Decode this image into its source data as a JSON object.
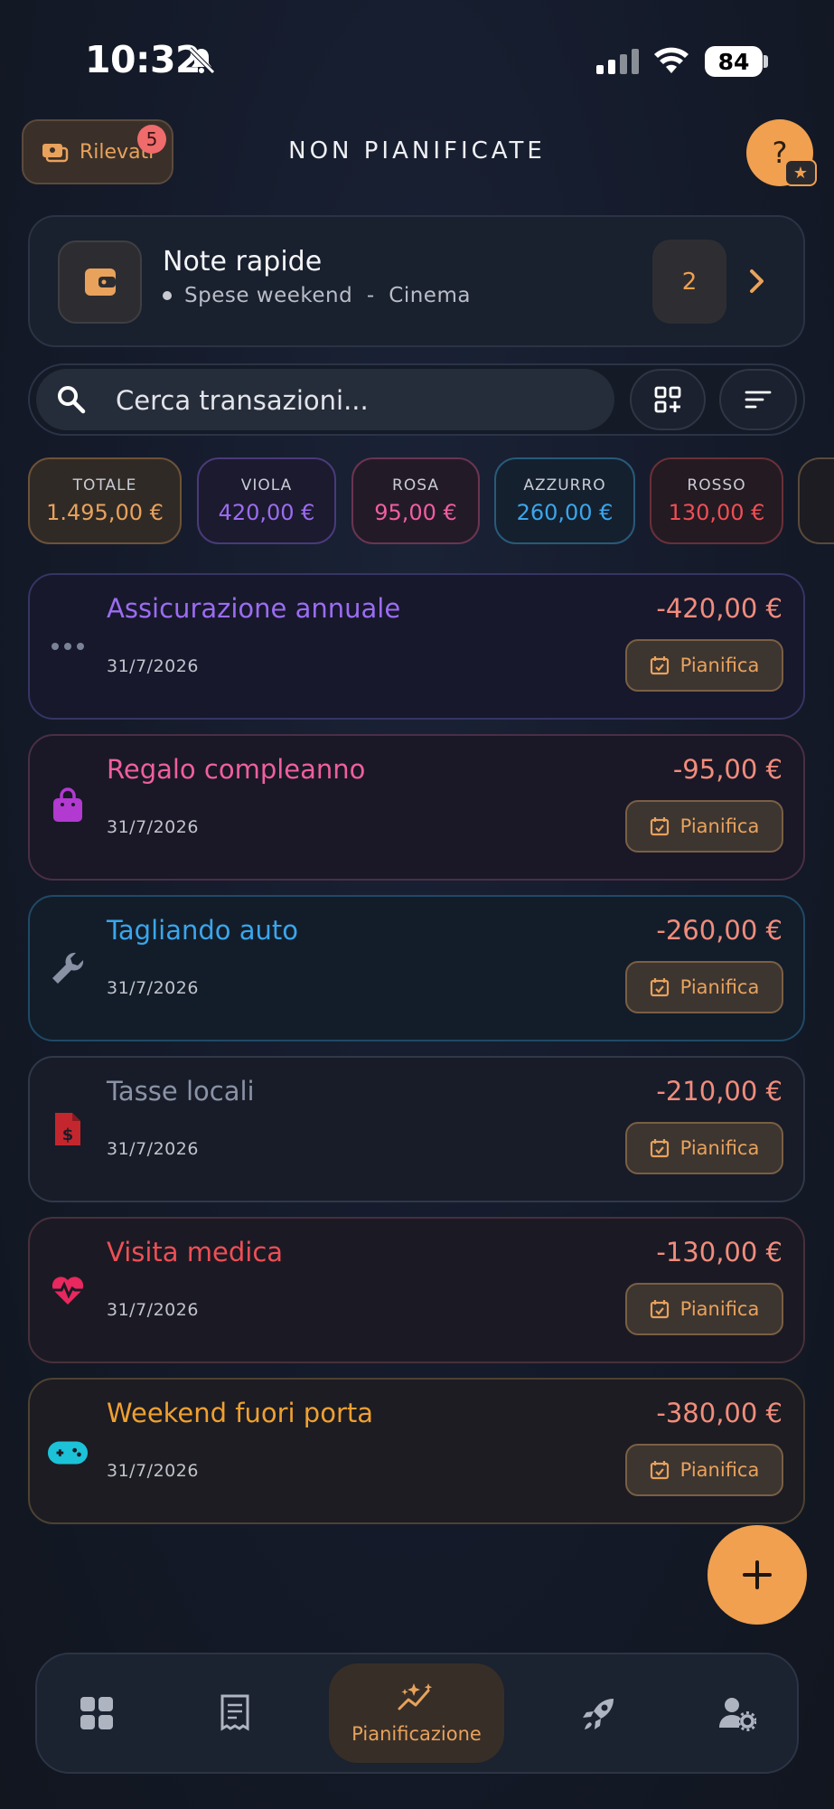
{
  "status_bar": {
    "time": "10:32",
    "battery": "84",
    "icons": [
      "bell-slash-icon",
      "signal-icon",
      "wifi-icon",
      "battery-icon"
    ]
  },
  "header": {
    "rilevati_label": "Rilevati",
    "rilevati_badge": "5",
    "title": "NON PIANIFICATE",
    "help_label": "?",
    "help_star": "★"
  },
  "note_rapide": {
    "title": "Note rapide",
    "subtitle": "Spese weekend  -  Cinema",
    "count": "2"
  },
  "search": {
    "placeholder": "Cerca transazioni..."
  },
  "chips": [
    {
      "label": "TOTALE",
      "value": "1.495,00 €",
      "color": "#e8a25c"
    },
    {
      "label": "VIOLA",
      "value": "420,00 €",
      "color": "#9b6cf0"
    },
    {
      "label": "ROSA",
      "value": "95,00 €",
      "color": "#ef5fa0"
    },
    {
      "label": "AZZURRO",
      "value": "260,00 €",
      "color": "#3aa6ec"
    },
    {
      "label": "ROSSO",
      "value": "130,00 €",
      "color": "#ee4f55"
    }
  ],
  "transactions": [
    {
      "title": "Assicurazione annuale",
      "date": "31/7/2026",
      "amount": "-420,00 €",
      "color": "#9b6cf0",
      "icon": "more-dots-icon",
      "action": "Pianifica"
    },
    {
      "title": "Regalo compleanno",
      "date": "31/7/2026",
      "amount": "-95,00 €",
      "color": "#ef5fa0",
      "icon": "shopping-bag-icon",
      "action": "Pianifica"
    },
    {
      "title": "Tagliando auto",
      "date": "31/7/2026",
      "amount": "-260,00 €",
      "color": "#3aa6ec",
      "icon": "wrench-icon",
      "action": "Pianifica"
    },
    {
      "title": "Tasse locali",
      "date": "31/7/2026",
      "amount": "-210,00 €",
      "color": "#8a93a6",
      "icon": "tax-document-icon",
      "action": "Pianifica"
    },
    {
      "title": "Visita medica",
      "date": "31/7/2026",
      "amount": "-130,00 €",
      "color": "#ee4f55",
      "icon": "heart-pulse-icon",
      "action": "Pianifica"
    },
    {
      "title": "Weekend fuori porta",
      "date": "31/7/2026",
      "amount": "-380,00 €",
      "color": "#f0a030",
      "icon": "gamepad-icon",
      "action": "Pianifica"
    }
  ],
  "fab": {
    "label": "+"
  },
  "bottom_nav": {
    "items": [
      "dashboard-icon",
      "receipt-icon",
      "planning-icon",
      "rocket-icon",
      "user-settings-icon"
    ],
    "active_label": "Pianificazione"
  }
}
